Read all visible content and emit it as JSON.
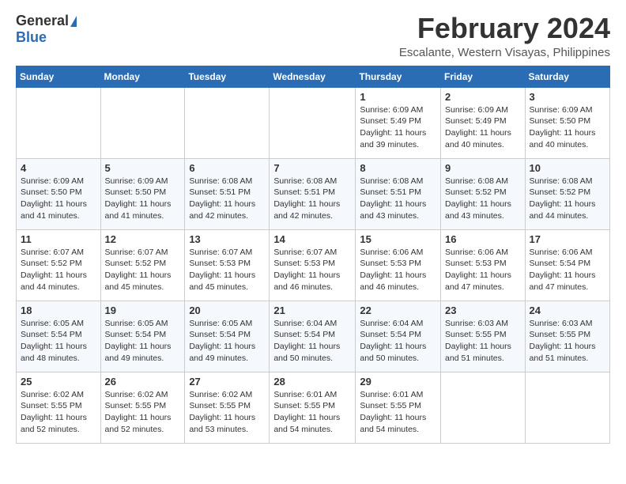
{
  "header": {
    "logo_general": "General",
    "logo_blue": "Blue",
    "month_title": "February 2024",
    "location": "Escalante, Western Visayas, Philippines"
  },
  "calendar": {
    "days_of_week": [
      "Sunday",
      "Monday",
      "Tuesday",
      "Wednesday",
      "Thursday",
      "Friday",
      "Saturday"
    ],
    "weeks": [
      [
        {
          "day": "",
          "info": ""
        },
        {
          "day": "",
          "info": ""
        },
        {
          "day": "",
          "info": ""
        },
        {
          "day": "",
          "info": ""
        },
        {
          "day": "1",
          "info": "Sunrise: 6:09 AM\nSunset: 5:49 PM\nDaylight: 11 hours and 39 minutes."
        },
        {
          "day": "2",
          "info": "Sunrise: 6:09 AM\nSunset: 5:49 PM\nDaylight: 11 hours and 40 minutes."
        },
        {
          "day": "3",
          "info": "Sunrise: 6:09 AM\nSunset: 5:50 PM\nDaylight: 11 hours and 40 minutes."
        }
      ],
      [
        {
          "day": "4",
          "info": "Sunrise: 6:09 AM\nSunset: 5:50 PM\nDaylight: 11 hours and 41 minutes."
        },
        {
          "day": "5",
          "info": "Sunrise: 6:09 AM\nSunset: 5:50 PM\nDaylight: 11 hours and 41 minutes."
        },
        {
          "day": "6",
          "info": "Sunrise: 6:08 AM\nSunset: 5:51 PM\nDaylight: 11 hours and 42 minutes."
        },
        {
          "day": "7",
          "info": "Sunrise: 6:08 AM\nSunset: 5:51 PM\nDaylight: 11 hours and 42 minutes."
        },
        {
          "day": "8",
          "info": "Sunrise: 6:08 AM\nSunset: 5:51 PM\nDaylight: 11 hours and 43 minutes."
        },
        {
          "day": "9",
          "info": "Sunrise: 6:08 AM\nSunset: 5:52 PM\nDaylight: 11 hours and 43 minutes."
        },
        {
          "day": "10",
          "info": "Sunrise: 6:08 AM\nSunset: 5:52 PM\nDaylight: 11 hours and 44 minutes."
        }
      ],
      [
        {
          "day": "11",
          "info": "Sunrise: 6:07 AM\nSunset: 5:52 PM\nDaylight: 11 hours and 44 minutes."
        },
        {
          "day": "12",
          "info": "Sunrise: 6:07 AM\nSunset: 5:52 PM\nDaylight: 11 hours and 45 minutes."
        },
        {
          "day": "13",
          "info": "Sunrise: 6:07 AM\nSunset: 5:53 PM\nDaylight: 11 hours and 45 minutes."
        },
        {
          "day": "14",
          "info": "Sunrise: 6:07 AM\nSunset: 5:53 PM\nDaylight: 11 hours and 46 minutes."
        },
        {
          "day": "15",
          "info": "Sunrise: 6:06 AM\nSunset: 5:53 PM\nDaylight: 11 hours and 46 minutes."
        },
        {
          "day": "16",
          "info": "Sunrise: 6:06 AM\nSunset: 5:53 PM\nDaylight: 11 hours and 47 minutes."
        },
        {
          "day": "17",
          "info": "Sunrise: 6:06 AM\nSunset: 5:54 PM\nDaylight: 11 hours and 47 minutes."
        }
      ],
      [
        {
          "day": "18",
          "info": "Sunrise: 6:05 AM\nSunset: 5:54 PM\nDaylight: 11 hours and 48 minutes."
        },
        {
          "day": "19",
          "info": "Sunrise: 6:05 AM\nSunset: 5:54 PM\nDaylight: 11 hours and 49 minutes."
        },
        {
          "day": "20",
          "info": "Sunrise: 6:05 AM\nSunset: 5:54 PM\nDaylight: 11 hours and 49 minutes."
        },
        {
          "day": "21",
          "info": "Sunrise: 6:04 AM\nSunset: 5:54 PM\nDaylight: 11 hours and 50 minutes."
        },
        {
          "day": "22",
          "info": "Sunrise: 6:04 AM\nSunset: 5:54 PM\nDaylight: 11 hours and 50 minutes."
        },
        {
          "day": "23",
          "info": "Sunrise: 6:03 AM\nSunset: 5:55 PM\nDaylight: 11 hours and 51 minutes."
        },
        {
          "day": "24",
          "info": "Sunrise: 6:03 AM\nSunset: 5:55 PM\nDaylight: 11 hours and 51 minutes."
        }
      ],
      [
        {
          "day": "25",
          "info": "Sunrise: 6:02 AM\nSunset: 5:55 PM\nDaylight: 11 hours and 52 minutes."
        },
        {
          "day": "26",
          "info": "Sunrise: 6:02 AM\nSunset: 5:55 PM\nDaylight: 11 hours and 52 minutes."
        },
        {
          "day": "27",
          "info": "Sunrise: 6:02 AM\nSunset: 5:55 PM\nDaylight: 11 hours and 53 minutes."
        },
        {
          "day": "28",
          "info": "Sunrise: 6:01 AM\nSunset: 5:55 PM\nDaylight: 11 hours and 54 minutes."
        },
        {
          "day": "29",
          "info": "Sunrise: 6:01 AM\nSunset: 5:55 PM\nDaylight: 11 hours and 54 minutes."
        },
        {
          "day": "",
          "info": ""
        },
        {
          "day": "",
          "info": ""
        }
      ]
    ]
  }
}
